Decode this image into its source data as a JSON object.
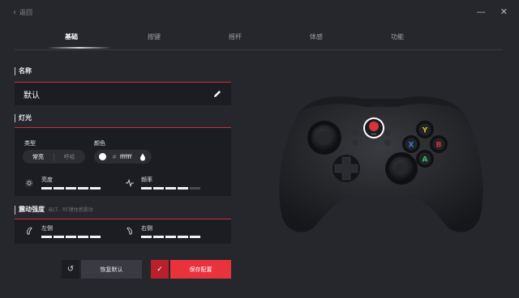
{
  "header": {
    "back_label": "返回",
    "minimize_glyph": "—",
    "close_glyph": "✕"
  },
  "tabs": [
    {
      "label": "基础",
      "active": true
    },
    {
      "label": "按键",
      "active": false
    },
    {
      "label": "摇杆",
      "active": false
    },
    {
      "label": "体感",
      "active": false
    },
    {
      "label": "功能",
      "active": false
    }
  ],
  "name_section": {
    "title": "名称",
    "value": "默认",
    "edit_icon": "pencil-icon"
  },
  "light_section": {
    "title": "灯光",
    "type_label": "类型",
    "type_options": [
      "常亮",
      "呼吸"
    ],
    "type_selected": "常亮",
    "color_label": "颜色",
    "color_hash": "#",
    "color_value": "ffffff",
    "color_swatch": "#ffffff",
    "brightness_label": "亮度",
    "brightness_level": 5,
    "frequency_label": "频率",
    "frequency_level": 4,
    "segment_count": 5
  },
  "vibration_section": {
    "title": "震动强度",
    "hint": "当LT、RT键体感震动",
    "left_label": "左侧",
    "left_level": 5,
    "right_label": "右侧",
    "right_level": 5
  },
  "actions": {
    "reset_label": "恢复默认",
    "save_label": "保存配置"
  },
  "controller": {
    "face_buttons": {
      "Y": "Y",
      "X": "X",
      "B": "B",
      "A": "A"
    },
    "colors": {
      "Y": "#d8b62c",
      "X": "#3a7bd5",
      "B": "#d6333c",
      "A": "#3cb96a"
    }
  },
  "colors": {
    "accent": "#e8333d",
    "panel": "#1c1d22",
    "background": "#26272c"
  }
}
